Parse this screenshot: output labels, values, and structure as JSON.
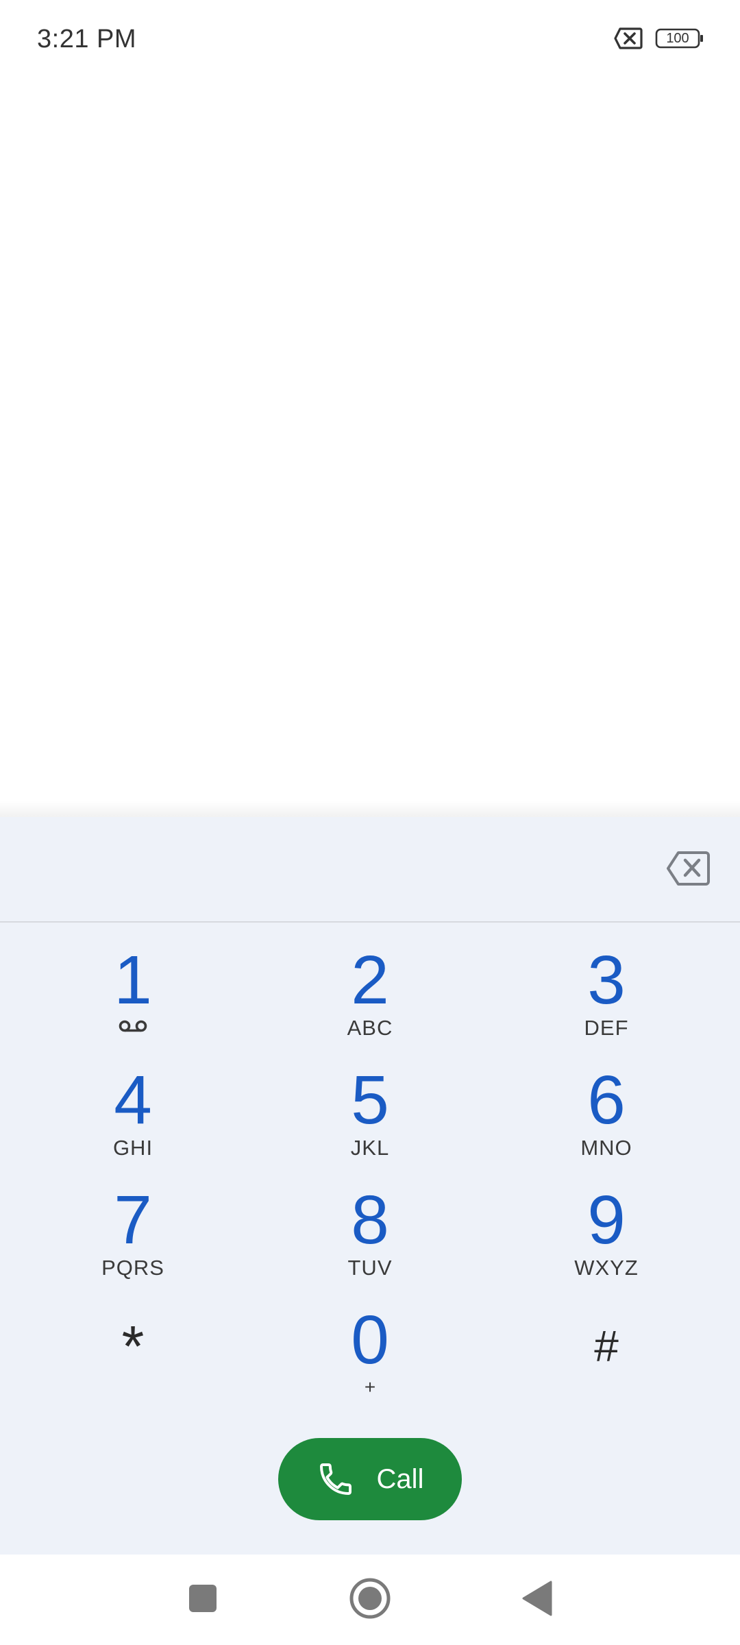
{
  "status_bar": {
    "time": "3:21 PM",
    "battery_level": "100",
    "icons": [
      "no-sim-icon",
      "battery-icon"
    ]
  },
  "dialpad": {
    "digits_value": "",
    "backspace_icon": "backspace-icon",
    "keys": [
      {
        "digit": "1",
        "letters": "",
        "icon": "voicemail-icon"
      },
      {
        "digit": "2",
        "letters": "ABC"
      },
      {
        "digit": "3",
        "letters": "DEF"
      },
      {
        "digit": "4",
        "letters": "GHI"
      },
      {
        "digit": "5",
        "letters": "JKL"
      },
      {
        "digit": "6",
        "letters": "MNO"
      },
      {
        "digit": "7",
        "letters": "PQRS"
      },
      {
        "digit": "8",
        "letters": "TUV"
      },
      {
        "digit": "9",
        "letters": "WXYZ"
      },
      {
        "digit": "*",
        "letters": ""
      },
      {
        "digit": "0",
        "letters": "+"
      },
      {
        "digit": "#",
        "letters": ""
      }
    ]
  },
  "call_button": {
    "label": "Call",
    "icon": "phone-icon"
  },
  "colors": {
    "accent_digit": "#1a5bc4",
    "call_green": "#1e8a3d",
    "sheet_bg": "#eef2f9"
  },
  "nav_bar": {
    "icons": [
      "recents-square-icon",
      "home-circle-icon",
      "back-triangle-icon"
    ]
  }
}
